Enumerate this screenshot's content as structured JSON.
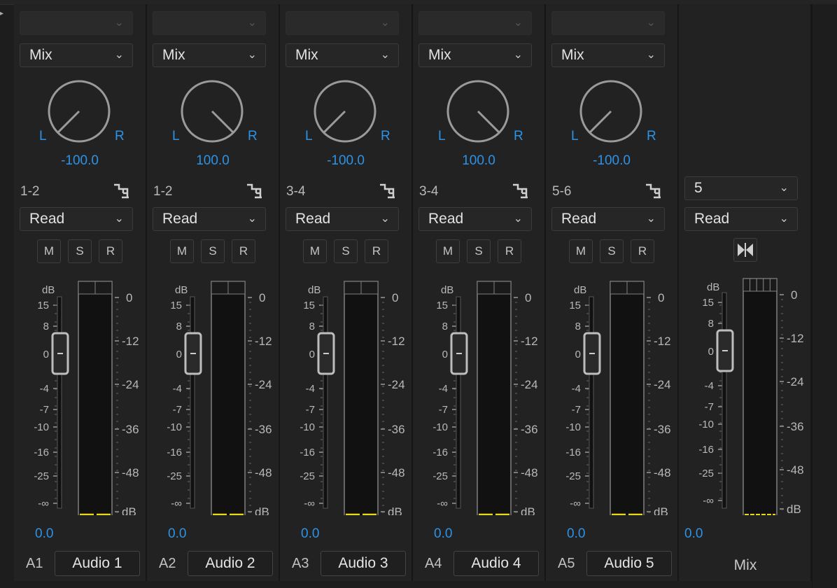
{
  "strips": [
    {
      "id": "A1",
      "name": "Audio 1",
      "mode": "Mix",
      "pan": "-100.0",
      "pan_l": "L",
      "pan_r": "R",
      "pan_angle": -135,
      "routing": "1-2",
      "automation": "Read",
      "mute": "M",
      "solo": "S",
      "record": "R",
      "gain": "0.0"
    },
    {
      "id": "A2",
      "name": "Audio 2",
      "mode": "Mix",
      "pan": "100.0",
      "pan_l": "L",
      "pan_r": "R",
      "pan_angle": 135,
      "routing": "1-2",
      "automation": "Read",
      "mute": "M",
      "solo": "S",
      "record": "R",
      "gain": "0.0"
    },
    {
      "id": "A3",
      "name": "Audio 3",
      "mode": "Mix",
      "pan": "-100.0",
      "pan_l": "L",
      "pan_r": "R",
      "pan_angle": -135,
      "routing": "3-4",
      "automation": "Read",
      "mute": "M",
      "solo": "S",
      "record": "R",
      "gain": "0.0"
    },
    {
      "id": "A4",
      "name": "Audio 4",
      "mode": "Mix",
      "pan": "100.0",
      "pan_l": "L",
      "pan_r": "R",
      "pan_angle": 135,
      "routing": "3-4",
      "automation": "Read",
      "mute": "M",
      "solo": "S",
      "record": "R",
      "gain": "0.0"
    },
    {
      "id": "A5",
      "name": "Audio 5",
      "mode": "Mix",
      "pan": "-100.0",
      "pan_l": "L",
      "pan_r": "R",
      "pan_angle": -135,
      "routing": "5-6",
      "automation": "Read",
      "mute": "M",
      "solo": "S",
      "record": "R",
      "gain": "0.0"
    }
  ],
  "master": {
    "name": "Mix",
    "channels": "5",
    "automation": "Read",
    "gain": "0.0"
  },
  "fader_scale": [
    "dB",
    "15",
    "8",
    "0",
    "-4",
    "-7",
    "-10",
    "-16",
    "-25",
    "-∞"
  ],
  "meter_scale": [
    "0",
    "-12",
    "-24",
    "-36",
    "-48",
    "dB"
  ],
  "colors": {
    "accent": "#2d93e6",
    "meter_signal": "#e8d81c",
    "bg": "#1d1d1d"
  }
}
